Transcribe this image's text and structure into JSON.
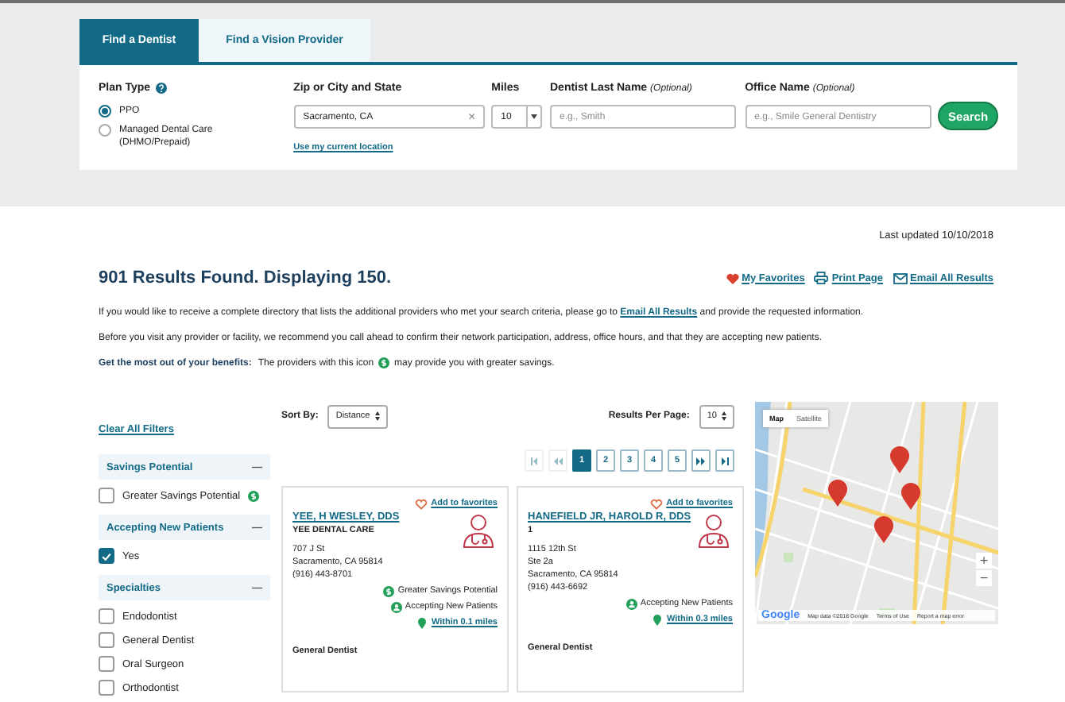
{
  "tabs": [
    {
      "label": "Find a Dentist",
      "selected": true
    },
    {
      "label": "Find a Vision Provider",
      "selected": false
    }
  ],
  "search": {
    "plan_type": {
      "label": "Plan Type",
      "options": [
        {
          "label": "PPO",
          "selected": true
        },
        {
          "label": "Managed Dental Care (DHMO/Prepaid)",
          "selected": false
        }
      ]
    },
    "location": {
      "label": "Zip or City and State",
      "value": "Sacramento, CA",
      "clear": "×",
      "link": "Use my current location"
    },
    "miles": {
      "label": "Miles",
      "value": "10"
    },
    "last_name": {
      "label": "Dentist Last Name",
      "note": "(Optional)",
      "placeholder": "e.g., Smith"
    },
    "office_name": {
      "label": "Office Name",
      "note": "(Optional)",
      "placeholder": "e.g., Smile General Dentistry"
    },
    "button": "Search"
  },
  "results": {
    "last_updated": "Last updated 10/10/2018",
    "heading": "901 Results Found. Displaying 150.",
    "actions": [
      {
        "kind": "favorites",
        "label": "My Favorites"
      },
      {
        "kind": "print",
        "label": "Print Page"
      },
      {
        "kind": "email",
        "label": "Email All Results"
      }
    ],
    "directory_notice": {
      "before": "If you would like to receive a complete directory that lists the additional providers who met your search criteria, please go to",
      "link": "Email All Results",
      "after": "and provide the requested information."
    },
    "visit_notice": "Before you visit any provider or facility, we recommend you call ahead to confirm their network participation, address, office hours, and that they are accepting new patients.",
    "benefits_notice": {
      "label": "Get the most out of your benefits:",
      "before": "The providers with this icon",
      "after": "may provide you with greater savings."
    }
  },
  "filters": {
    "clear_all": "Clear All Filters",
    "groups": [
      {
        "title": "Savings Potential",
        "toggle": "—",
        "options": [
          {
            "label": "Greater Savings Potential",
            "checked": false,
            "savings": true
          }
        ]
      },
      {
        "title": "Accepting New Patients",
        "toggle": "—",
        "options": [
          {
            "label": "Yes",
            "checked": true,
            "savings": false
          }
        ]
      },
      {
        "title": "Specialties",
        "toggle": "—",
        "options": [
          {
            "label": "Endodontist",
            "checked": false,
            "savings": false
          },
          {
            "label": "General Dentist",
            "checked": false,
            "savings": false
          },
          {
            "label": "Oral Surgeon",
            "checked": false,
            "savings": false
          },
          {
            "label": "Orthodontist",
            "checked": false,
            "savings": false
          }
        ]
      }
    ]
  },
  "toolbar": {
    "sort": {
      "label": "Sort By:",
      "value": "Distance"
    },
    "per_page": {
      "label": "Results Per Page:",
      "value": "10"
    }
  },
  "pagination": {
    "nav": [
      {
        "kind": "first",
        "disabled": true
      },
      {
        "kind": "previous",
        "disabled": true
      },
      {
        "kind": "next",
        "disabled": false
      },
      {
        "kind": "last",
        "disabled": false
      }
    ],
    "pages": [
      {
        "label": "1",
        "selected": true
      },
      {
        "label": "2",
        "selected": false
      },
      {
        "label": "3",
        "selected": false
      },
      {
        "label": "4",
        "selected": false
      },
      {
        "label": "5",
        "selected": false
      }
    ]
  },
  "cards": [
    {
      "favorite": "Add to favorites",
      "name": "YEE, H WESLEY, DDS",
      "practice": "YEE DENTAL CARE",
      "address": [
        "707 J St",
        "Sacramento, CA 95814"
      ],
      "phone": "(916) 443-8701",
      "badges": [
        {
          "kind": "savings",
          "label": "Greater Savings Potential"
        },
        {
          "kind": "accepting",
          "label": "Accepting New Patients"
        }
      ],
      "distance": "Within 0.1 miles",
      "specialty": "General Dentist"
    },
    {
      "favorite": "Add to favorites",
      "name": "HANEFIELD JR, HAROLD R, DDS",
      "practice": "1",
      "address": [
        "1115 12th St",
        "Ste 2a",
        "Sacramento, CA 95814"
      ],
      "phone": "(916) 443-6692",
      "badges": [
        {
          "kind": "accepting",
          "label": "Accepting New Patients"
        }
      ],
      "distance": "Within 0.3 miles",
      "specialty": "General Dentist"
    }
  ],
  "map": {
    "types": [
      {
        "label": "Map",
        "selected": true
      },
      {
        "label": "Satellite",
        "selected": false
      }
    ],
    "zoom_in": "+",
    "zoom_out": "−",
    "logo": "Google",
    "attribution": "Map data ©2018 Google",
    "terms": "Terms of Use",
    "report": "Report a map error"
  }
}
